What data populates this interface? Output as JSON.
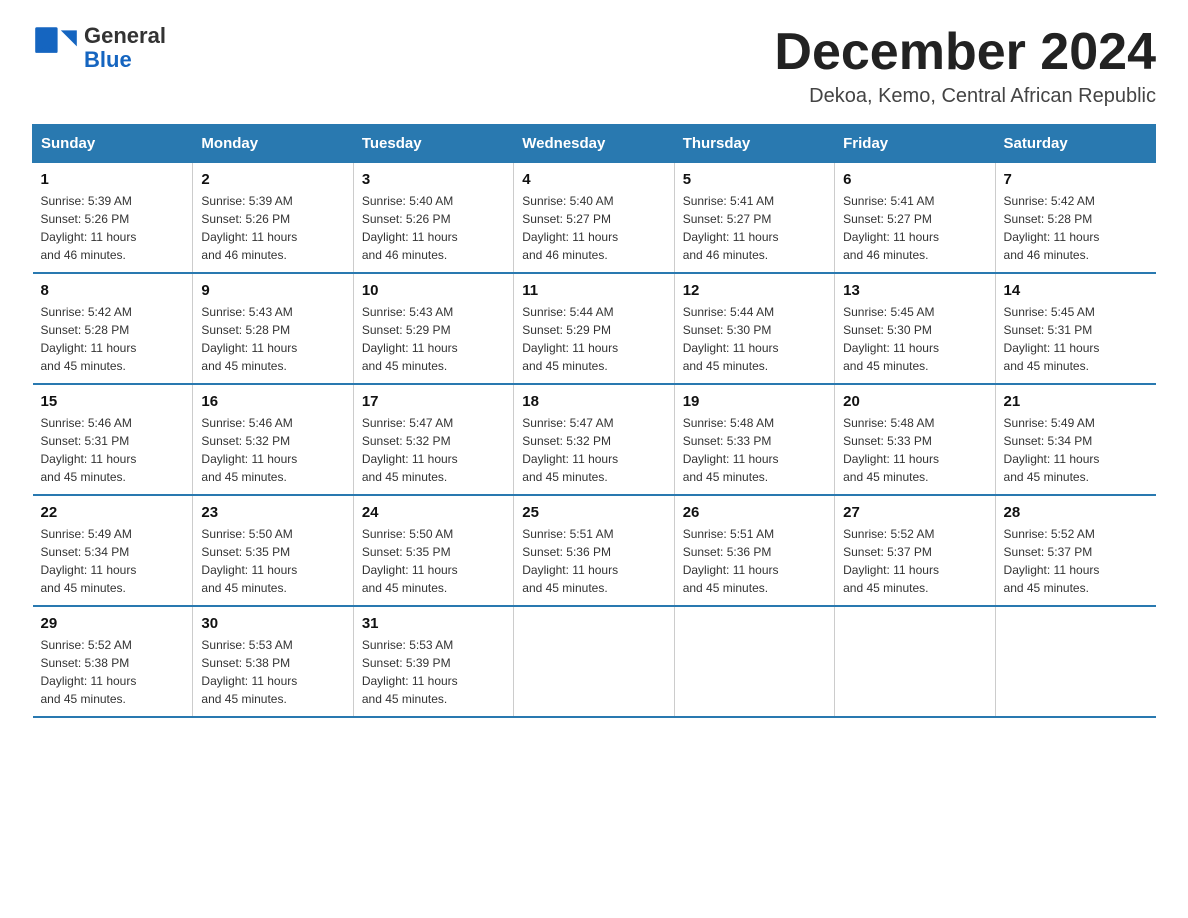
{
  "header": {
    "title": "December 2024",
    "subtitle": "Dekoa, Kemo, Central African Republic",
    "logo_general": "General",
    "logo_blue": "Blue"
  },
  "columns": [
    "Sunday",
    "Monday",
    "Tuesday",
    "Wednesday",
    "Thursday",
    "Friday",
    "Saturday"
  ],
  "weeks": [
    [
      {
        "day": "1",
        "sunrise": "5:39 AM",
        "sunset": "5:26 PM",
        "daylight": "11 hours and 46 minutes."
      },
      {
        "day": "2",
        "sunrise": "5:39 AM",
        "sunset": "5:26 PM",
        "daylight": "11 hours and 46 minutes."
      },
      {
        "day": "3",
        "sunrise": "5:40 AM",
        "sunset": "5:26 PM",
        "daylight": "11 hours and 46 minutes."
      },
      {
        "day": "4",
        "sunrise": "5:40 AM",
        "sunset": "5:27 PM",
        "daylight": "11 hours and 46 minutes."
      },
      {
        "day": "5",
        "sunrise": "5:41 AM",
        "sunset": "5:27 PM",
        "daylight": "11 hours and 46 minutes."
      },
      {
        "day": "6",
        "sunrise": "5:41 AM",
        "sunset": "5:27 PM",
        "daylight": "11 hours and 46 minutes."
      },
      {
        "day": "7",
        "sunrise": "5:42 AM",
        "sunset": "5:28 PM",
        "daylight": "11 hours and 46 minutes."
      }
    ],
    [
      {
        "day": "8",
        "sunrise": "5:42 AM",
        "sunset": "5:28 PM",
        "daylight": "11 hours and 45 minutes."
      },
      {
        "day": "9",
        "sunrise": "5:43 AM",
        "sunset": "5:28 PM",
        "daylight": "11 hours and 45 minutes."
      },
      {
        "day": "10",
        "sunrise": "5:43 AM",
        "sunset": "5:29 PM",
        "daylight": "11 hours and 45 minutes."
      },
      {
        "day": "11",
        "sunrise": "5:44 AM",
        "sunset": "5:29 PM",
        "daylight": "11 hours and 45 minutes."
      },
      {
        "day": "12",
        "sunrise": "5:44 AM",
        "sunset": "5:30 PM",
        "daylight": "11 hours and 45 minutes."
      },
      {
        "day": "13",
        "sunrise": "5:45 AM",
        "sunset": "5:30 PM",
        "daylight": "11 hours and 45 minutes."
      },
      {
        "day": "14",
        "sunrise": "5:45 AM",
        "sunset": "5:31 PM",
        "daylight": "11 hours and 45 minutes."
      }
    ],
    [
      {
        "day": "15",
        "sunrise": "5:46 AM",
        "sunset": "5:31 PM",
        "daylight": "11 hours and 45 minutes."
      },
      {
        "day": "16",
        "sunrise": "5:46 AM",
        "sunset": "5:32 PM",
        "daylight": "11 hours and 45 minutes."
      },
      {
        "day": "17",
        "sunrise": "5:47 AM",
        "sunset": "5:32 PM",
        "daylight": "11 hours and 45 minutes."
      },
      {
        "day": "18",
        "sunrise": "5:47 AM",
        "sunset": "5:32 PM",
        "daylight": "11 hours and 45 minutes."
      },
      {
        "day": "19",
        "sunrise": "5:48 AM",
        "sunset": "5:33 PM",
        "daylight": "11 hours and 45 minutes."
      },
      {
        "day": "20",
        "sunrise": "5:48 AM",
        "sunset": "5:33 PM",
        "daylight": "11 hours and 45 minutes."
      },
      {
        "day": "21",
        "sunrise": "5:49 AM",
        "sunset": "5:34 PM",
        "daylight": "11 hours and 45 minutes."
      }
    ],
    [
      {
        "day": "22",
        "sunrise": "5:49 AM",
        "sunset": "5:34 PM",
        "daylight": "11 hours and 45 minutes."
      },
      {
        "day": "23",
        "sunrise": "5:50 AM",
        "sunset": "5:35 PM",
        "daylight": "11 hours and 45 minutes."
      },
      {
        "day": "24",
        "sunrise": "5:50 AM",
        "sunset": "5:35 PM",
        "daylight": "11 hours and 45 minutes."
      },
      {
        "day": "25",
        "sunrise": "5:51 AM",
        "sunset": "5:36 PM",
        "daylight": "11 hours and 45 minutes."
      },
      {
        "day": "26",
        "sunrise": "5:51 AM",
        "sunset": "5:36 PM",
        "daylight": "11 hours and 45 minutes."
      },
      {
        "day": "27",
        "sunrise": "5:52 AM",
        "sunset": "5:37 PM",
        "daylight": "11 hours and 45 minutes."
      },
      {
        "day": "28",
        "sunrise": "5:52 AM",
        "sunset": "5:37 PM",
        "daylight": "11 hours and 45 minutes."
      }
    ],
    [
      {
        "day": "29",
        "sunrise": "5:52 AM",
        "sunset": "5:38 PM",
        "daylight": "11 hours and 45 minutes."
      },
      {
        "day": "30",
        "sunrise": "5:53 AM",
        "sunset": "5:38 PM",
        "daylight": "11 hours and 45 minutes."
      },
      {
        "day": "31",
        "sunrise": "5:53 AM",
        "sunset": "5:39 PM",
        "daylight": "11 hours and 45 minutes."
      },
      {
        "day": "",
        "sunrise": "",
        "sunset": "",
        "daylight": ""
      },
      {
        "day": "",
        "sunrise": "",
        "sunset": "",
        "daylight": ""
      },
      {
        "day": "",
        "sunrise": "",
        "sunset": "",
        "daylight": ""
      },
      {
        "day": "",
        "sunrise": "",
        "sunset": "",
        "daylight": ""
      }
    ]
  ],
  "sunrise_label": "Sunrise:",
  "sunset_label": "Sunset:",
  "daylight_label": "Daylight:"
}
